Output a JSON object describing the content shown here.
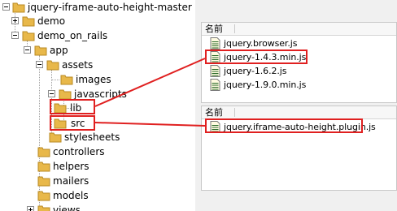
{
  "tree": {
    "items": [
      {
        "label": "jquery-iframe-auto-height-master",
        "expander": "minus"
      },
      {
        "label": "demo",
        "expander": "plus"
      },
      {
        "label": "demo_on_rails",
        "expander": "minus"
      },
      {
        "label": "app",
        "expander": "minus"
      },
      {
        "label": "assets",
        "expander": "minus"
      },
      {
        "label": "images",
        "expander": ""
      },
      {
        "label": "javascripts",
        "expander": "minus"
      },
      {
        "label": "lib",
        "expander": ""
      },
      {
        "label": "src",
        "expander": ""
      },
      {
        "label": "stylesheets",
        "expander": ""
      },
      {
        "label": "controllers",
        "expander": ""
      },
      {
        "label": "helpers",
        "expander": ""
      },
      {
        "label": "mailers",
        "expander": ""
      },
      {
        "label": "models",
        "expander": ""
      },
      {
        "label": "views",
        "expander": "plus"
      }
    ]
  },
  "lib_list": {
    "header": "名前",
    "files": [
      "jquery.browser.js",
      "jquery-1.4.3.min.js",
      "jquery-1.6.2.js",
      "jquery-1.9.0.min.js"
    ]
  },
  "src_list": {
    "header": "名前",
    "files": [
      "jquery.iframe-auto-height.plugin.js"
    ]
  },
  "colors": {
    "highlight": "#e02020",
    "folder": "#e8b84a",
    "panel_bg": "#f0f0f0"
  }
}
